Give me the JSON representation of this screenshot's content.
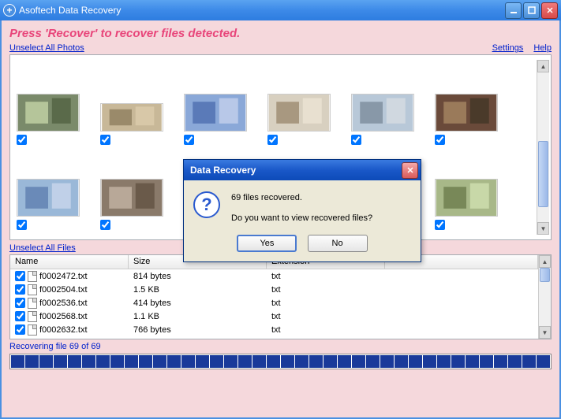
{
  "app": {
    "title": "Asoftech Data Recovery"
  },
  "banner": "Press 'Recover' to recover files detected.",
  "links": {
    "unselect_photos": "Unselect All Photos",
    "unselect_files": "Unselect All Files",
    "settings": "Settings",
    "help": "Help"
  },
  "photos": [
    {
      "checked": true,
      "h": 48
    },
    {
      "checked": true,
      "h": 36
    },
    {
      "checked": true,
      "h": 48
    },
    {
      "checked": true,
      "h": 48
    },
    {
      "checked": true,
      "h": 48
    },
    {
      "checked": true,
      "h": 48
    },
    {
      "checked": true,
      "h": 48
    },
    {
      "checked": true,
      "h": 48
    },
    {
      "checked": false,
      "h": 48
    },
    {
      "checked": false,
      "h": 48
    },
    {
      "checked": true,
      "h": 48
    },
    {
      "checked": true,
      "h": 48
    },
    {
      "checked": false,
      "h": 10
    }
  ],
  "file_columns": {
    "name": "Name",
    "size": "Size",
    "ext": "Extension"
  },
  "files": [
    {
      "name": "f0002472.txt",
      "size": "814 bytes",
      "ext": "txt",
      "checked": true
    },
    {
      "name": "f0002504.txt",
      "size": "1.5 KB",
      "ext": "txt",
      "checked": true
    },
    {
      "name": "f0002536.txt",
      "size": "414 bytes",
      "ext": "txt",
      "checked": true
    },
    {
      "name": "f0002568.txt",
      "size": "1.1 KB",
      "ext": "txt",
      "checked": true
    },
    {
      "name": "f0002632.txt",
      "size": "766 bytes",
      "ext": "txt",
      "checked": true
    }
  ],
  "progress": {
    "label": "Recovering file 69 of 69",
    "segments": 38
  },
  "dialog": {
    "title": "Data Recovery",
    "line1": "69 files recovered.",
    "line2": "Do you want to view recovered files?",
    "yes": "Yes",
    "no": "No"
  }
}
